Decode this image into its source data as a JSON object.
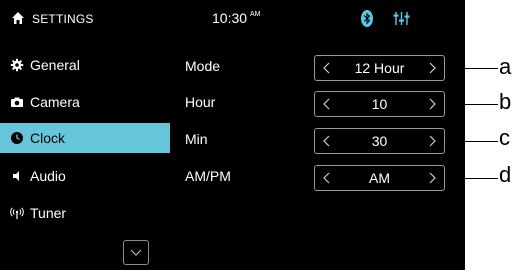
{
  "statusbar": {
    "title": "SETTINGS",
    "time": "10:30",
    "ampm": "AM",
    "icons": [
      "home-icon",
      "bluetooth-icon",
      "equalizer-icon"
    ],
    "accent_color": "#5bc8e8"
  },
  "sidebar": {
    "items": [
      {
        "label": "General",
        "icon": "gear-icon"
      },
      {
        "label": "Camera",
        "icon": "camera-icon"
      },
      {
        "label": "Clock",
        "icon": "clock-icon",
        "active": true
      },
      {
        "label": "Audio",
        "icon": "speaker-icon"
      },
      {
        "label": "Tuner",
        "icon": "antenna-icon"
      }
    ],
    "more_icon": "chevron-down-icon",
    "active_color": "#66c6d9"
  },
  "rows": [
    {
      "label": "Mode",
      "value": "12 Hour",
      "callout": "a"
    },
    {
      "label": "Hour",
      "value": "10",
      "callout": "b"
    },
    {
      "label": "Min",
      "value": "30",
      "callout": "c"
    },
    {
      "label": "AM/PM",
      "value": "AM",
      "callout": "d"
    }
  ]
}
